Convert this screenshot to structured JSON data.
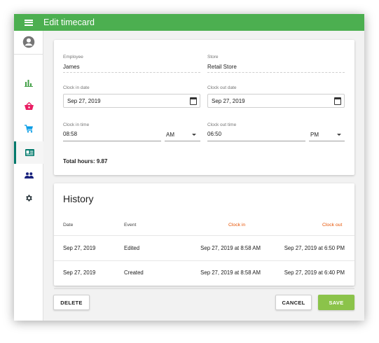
{
  "header": {
    "title": "Edit timecard"
  },
  "sidebar": {
    "items": [
      {
        "icon": "bar-chart-icon",
        "color": "#43a047"
      },
      {
        "icon": "basket-icon",
        "color": "#e91e63"
      },
      {
        "icon": "cart-icon",
        "color": "#039be5"
      },
      {
        "icon": "badge-icon",
        "color": "#00796b",
        "active": true
      },
      {
        "icon": "people-icon",
        "color": "#1a237e"
      },
      {
        "icon": "gear-icon",
        "color": "#263238"
      }
    ]
  },
  "form": {
    "employee_label": "Employee",
    "employee_value": "James",
    "store_label": "Store",
    "store_value": "Retail Store",
    "clock_in_date_label": "Clock in date",
    "clock_in_date_value": "Sep 27, 2019",
    "clock_out_date_label": "Clock out date",
    "clock_out_date_value": "Sep 27, 2019",
    "clock_in_time_label": "Clock in time",
    "clock_in_time_value": "08:58",
    "clock_in_ampm": "AM",
    "clock_out_time_label": "Clock out time",
    "clock_out_time_value": "06:50",
    "clock_out_ampm": "PM",
    "total_hours": "Total hours: 9.87"
  },
  "history": {
    "title": "History",
    "columns": [
      "Date",
      "Event",
      "Clock in",
      "Clock out"
    ],
    "rows": [
      {
        "date": "Sep 27, 2019",
        "event": "Edited",
        "clock_in": "Sep 27, 2019 at  8:58 AM",
        "clock_out": "Sep 27, 2019 at  6:50 PM"
      },
      {
        "date": "Sep 27, 2019",
        "event": "Created",
        "clock_in": "Sep 27, 2019 at  8:58 AM",
        "clock_out": "Sep 27, 2019 at  6:40 PM"
      }
    ]
  },
  "actions": {
    "delete_label": "DELETE",
    "cancel_label": "CANCEL",
    "save_label": "SAVE"
  },
  "colors": {
    "topbar": "#4caf50",
    "save": "#8bc34a",
    "clock_in_header": "#e65100"
  }
}
